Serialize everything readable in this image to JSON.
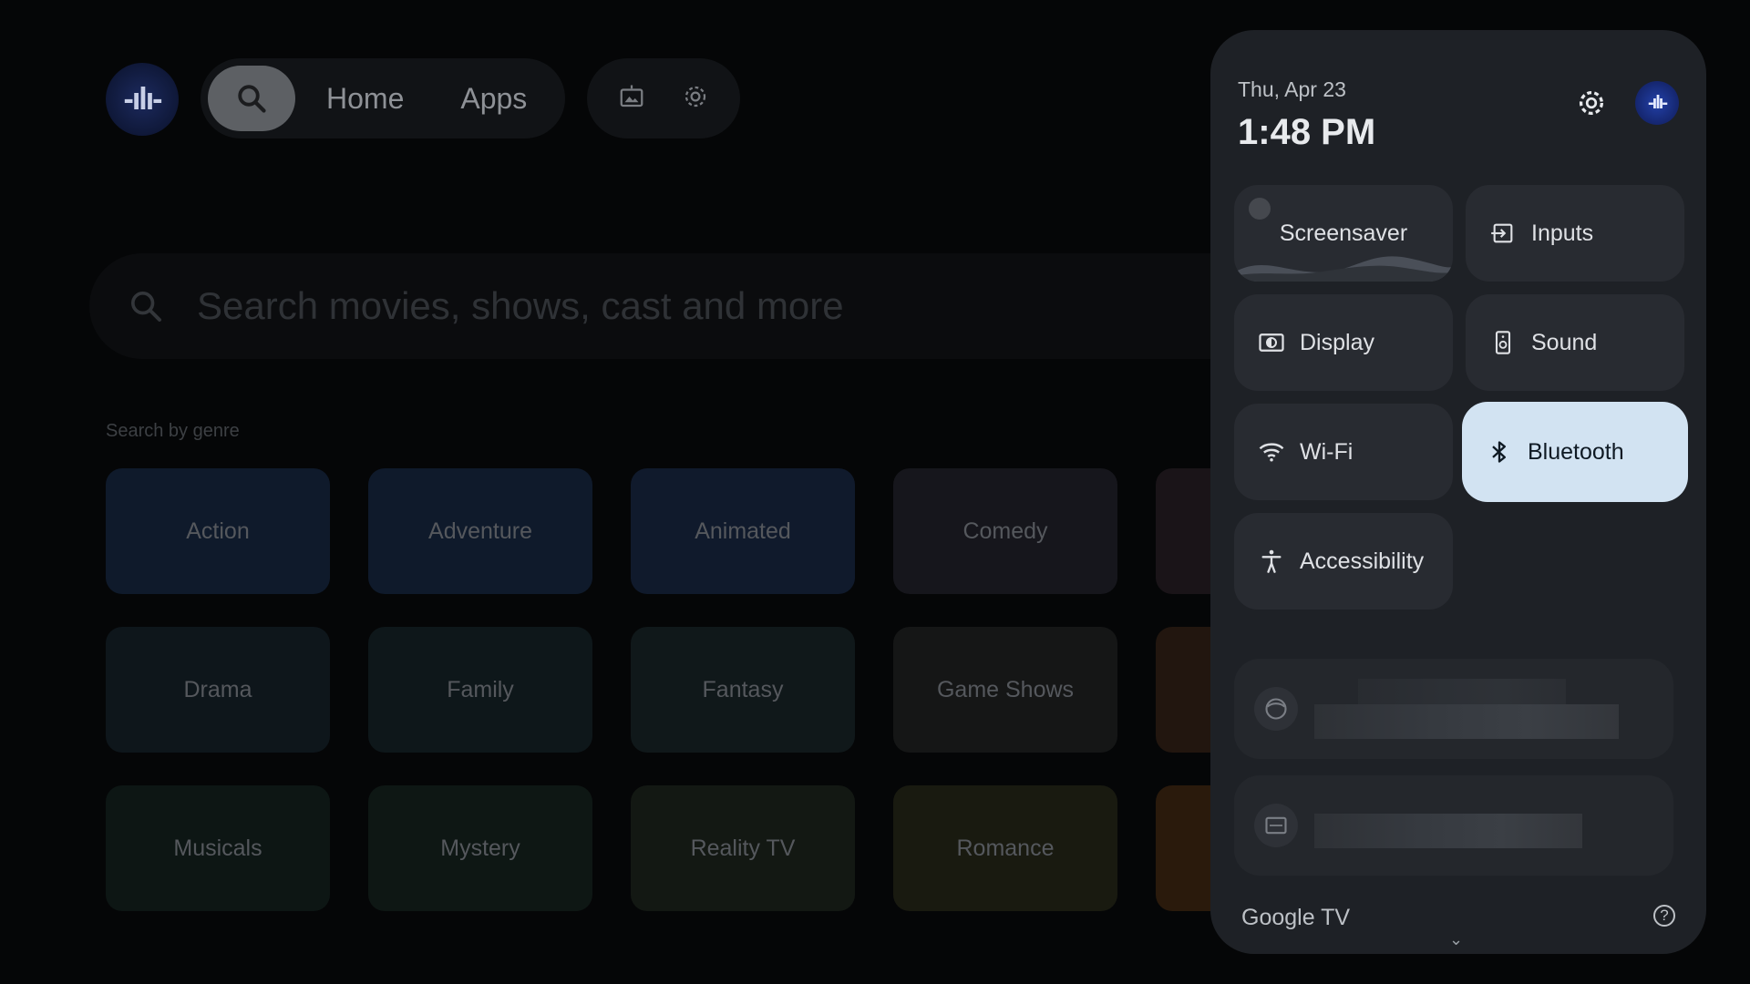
{
  "top_nav": {
    "search_icon": "search-icon",
    "home_label": "Home",
    "apps_label": "Apps",
    "icons": [
      "photo-frame-icon",
      "settings-gear-icon"
    ]
  },
  "search": {
    "placeholder": "Search movies, shows, cast and more"
  },
  "genres": {
    "title": "Search by genre",
    "tiles": [
      {
        "label": "Action",
        "color": "#0f1a2b"
      },
      {
        "label": "Adventure",
        "color": "#0f1a2b"
      },
      {
        "label": "Animated",
        "color": "#101a2c"
      },
      {
        "label": "Comedy",
        "color": "#16161c"
      },
      {
        "label": "Drama",
        "color": "#0e161b"
      },
      {
        "label": "Family",
        "color": "#0e171a"
      },
      {
        "label": "Fantasy",
        "color": "#10181a"
      },
      {
        "label": "Game Shows",
        "color": "#151616"
      },
      {
        "label": "Musicals",
        "color": "#0d1614"
      },
      {
        "label": "Mystery",
        "color": "#0e1714"
      },
      {
        "label": "Reality TV",
        "color": "#131813"
      },
      {
        "label": "Romance",
        "color": "#191a10"
      }
    ]
  },
  "quick_settings": {
    "date": "Thu, Apr 23",
    "time": "1:48 PM",
    "tiles": {
      "screensaver": "Screensaver",
      "inputs": "Inputs",
      "display": "Display",
      "sound": "Sound",
      "wifi": "Wi-Fi",
      "bluetooth": "Bluetooth",
      "accessibility": "Accessibility"
    },
    "active_tile": "Bluetooth",
    "footer_brand": "Google TV",
    "help_symbol": "?",
    "chevron": "⌄"
  },
  "colors": {
    "panel_bg": "#1e2126",
    "tile_bg": "#282b31",
    "active_tile_bg": "#d2e3f2"
  }
}
